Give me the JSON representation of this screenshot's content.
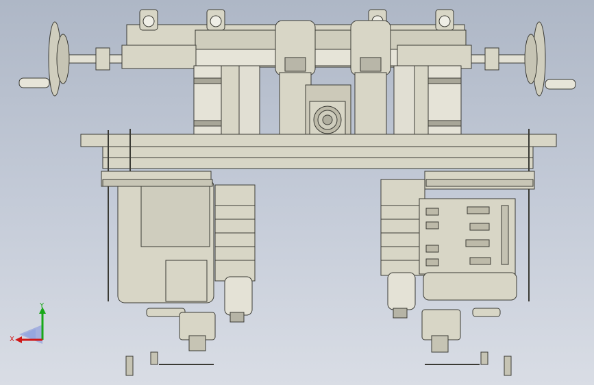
{
  "viewport": {
    "background_top": "#aeb7c6",
    "background_bottom": "#d9dde5",
    "model_fill": "#d8d6c6",
    "model_stroke": "#3a3a34"
  },
  "triad": {
    "x_label": "X",
    "y_label": "Y",
    "x_color": "#d01818",
    "y_color": "#18a818",
    "z_color": "#1836d8"
  }
}
